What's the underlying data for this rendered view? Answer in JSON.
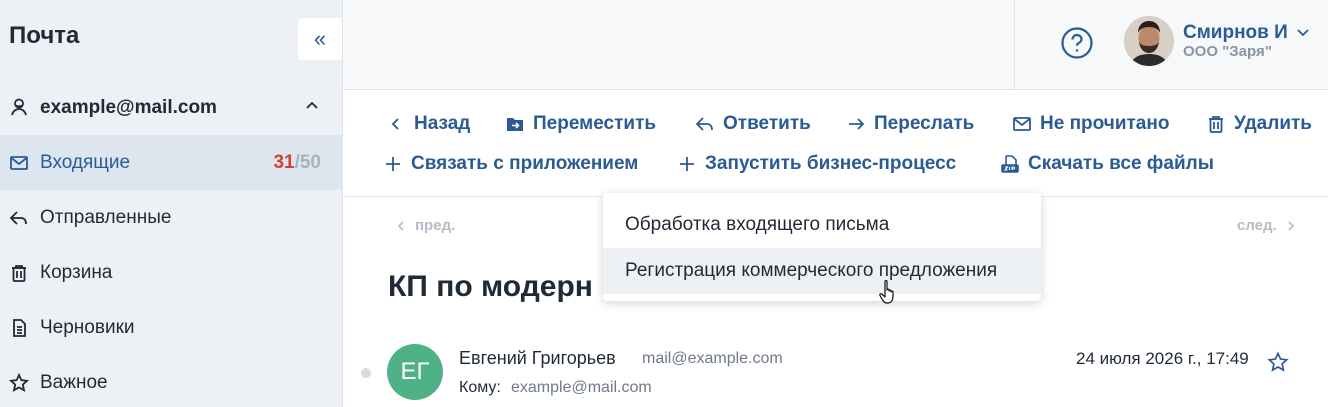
{
  "sidebar": {
    "title": "Почта",
    "collapse_glyph": "«",
    "account": "example@mail.com",
    "folders": [
      {
        "label": "Входящие",
        "icon": "envelope-icon"
      },
      {
        "label": "Отправленные",
        "icon": "reply-icon"
      },
      {
        "label": "Корзина",
        "icon": "trash-icon"
      },
      {
        "label": "Черновики",
        "icon": "document-icon"
      },
      {
        "label": "Важное",
        "icon": "star-icon"
      }
    ],
    "inbox_unread": "31",
    "inbox_sep": "/",
    "inbox_total": "50"
  },
  "header": {
    "user_name": "Смирнов И",
    "user_org": "ООО \"Заря\""
  },
  "toolbar": {
    "back": "Назад",
    "move": "Переместить",
    "reply": "Ответить",
    "forward": "Переслать",
    "unread": "Не прочитано",
    "delete": "Удалить",
    "link_app": "Связать с приложением",
    "run_process": "Запустить бизнес-процесс",
    "download_all": "Скачать все файлы"
  },
  "dropdown": {
    "items": [
      "Обработка входящего письма",
      "Регистрация коммерческого предложения"
    ]
  },
  "message": {
    "prev": "пред.",
    "next": "след.",
    "subject": "КП по модерн",
    "sender_initials": "ЕГ",
    "sender_name": "Евгений Григорьев",
    "sender_email": "mail@example.com",
    "to_label": "Кому:",
    "to_value": "example@mail.com",
    "date": "24 июля 2026 г., 17:49"
  },
  "colors": {
    "accent": "#2b5b94",
    "unread": "#d9412f",
    "sidebar_bg": "#edf1f5",
    "avatar_green": "#4fb287"
  }
}
